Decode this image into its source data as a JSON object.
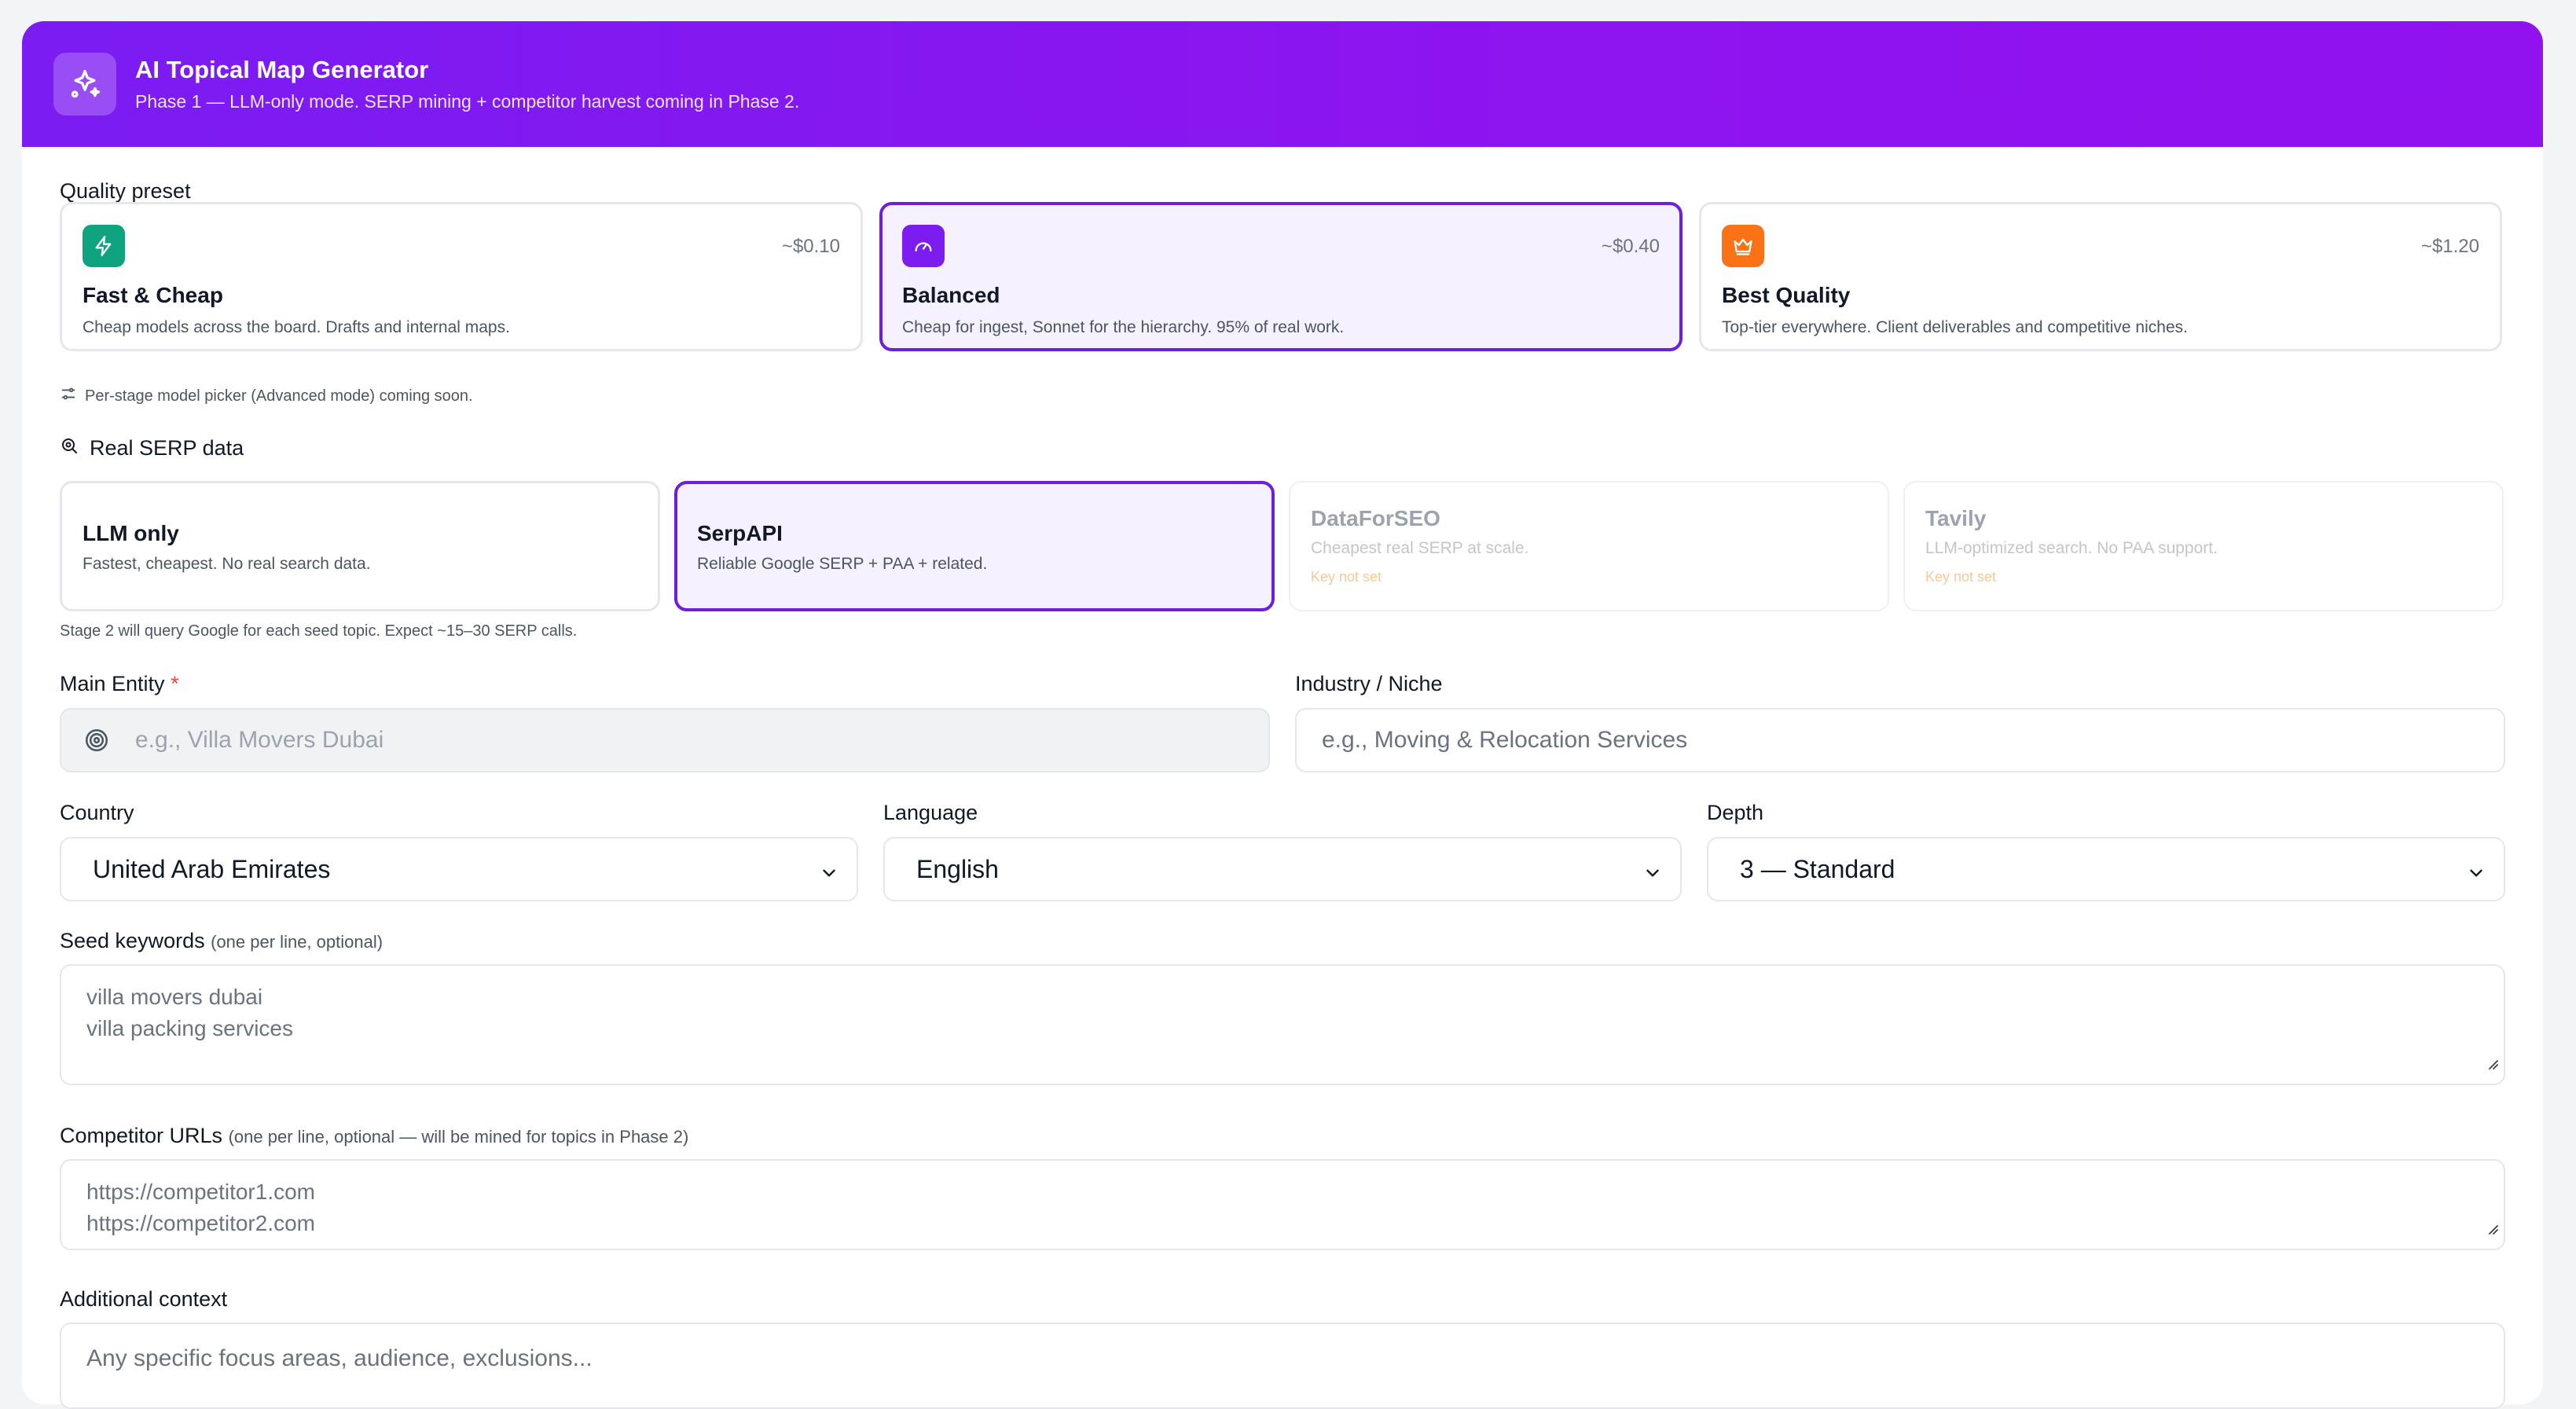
{
  "header": {
    "title": "AI Topical Map Generator",
    "subtitle": "Phase 1 — LLM-only mode. SERP mining + competitor harvest coming in Phase 2."
  },
  "quality": {
    "label": "Quality preset",
    "presets": [
      {
        "price": "~$0.10",
        "title": "Fast & Cheap",
        "desc": "Cheap models across the board. Drafts and internal maps.",
        "icon": "lightning-icon",
        "color": "#10a37f"
      },
      {
        "price": "~$0.40",
        "title": "Balanced",
        "desc": "Cheap for ingest, Sonnet for the hierarchy. 95% of real work.",
        "icon": "gauge-icon",
        "color": "#7c1cf0",
        "selected": true
      },
      {
        "price": "~$1.20",
        "title": "Best Quality",
        "desc": "Top-tier everywhere. Client deliverables and competitive niches.",
        "icon": "crown-icon",
        "color": "#f97316"
      }
    ],
    "note": "Per-stage model picker (Advanced mode) coming soon."
  },
  "serp": {
    "label": "Real SERP data",
    "options": [
      {
        "title": "LLM only",
        "desc": "Fastest, cheapest. No real search data."
      },
      {
        "title": "SerpAPI",
        "desc": "Reliable Google SERP + PAA + related.",
        "selected": true
      },
      {
        "title": "DataForSEO",
        "desc": "Cheapest real SERP at scale.",
        "warn": "Key not set",
        "disabled": true
      },
      {
        "title": "Tavily",
        "desc": "LLM-optimized search. No PAA support.",
        "warn": "Key not set",
        "disabled": true
      }
    ],
    "note": "Stage 2 will query Google for each seed topic. Expect ~15–30 SERP calls."
  },
  "form": {
    "main_entity": {
      "label": "Main Entity",
      "required": "*",
      "placeholder": "e.g., Villa Movers Dubai"
    },
    "industry": {
      "label": "Industry / Niche",
      "placeholder": "e.g., Moving & Relocation Services"
    },
    "country": {
      "label": "Country",
      "value": "United Arab Emirates"
    },
    "language": {
      "label": "Language",
      "value": "English"
    },
    "depth": {
      "label": "Depth",
      "value": "3 — Standard"
    },
    "seeds": {
      "label": "Seed keywords",
      "hint": "(one per line, optional)",
      "line1": "villa movers dubai",
      "line2": "villa packing services"
    },
    "competitors": {
      "label": "Competitor URLs",
      "hint": "(one per line, optional — will be mined for topics in Phase 2)",
      "line1": "https://competitor1.com",
      "line2": "https://competitor2.com"
    },
    "context": {
      "label": "Additional context",
      "placeholder": "Any specific focus areas, audience, exclusions..."
    }
  }
}
